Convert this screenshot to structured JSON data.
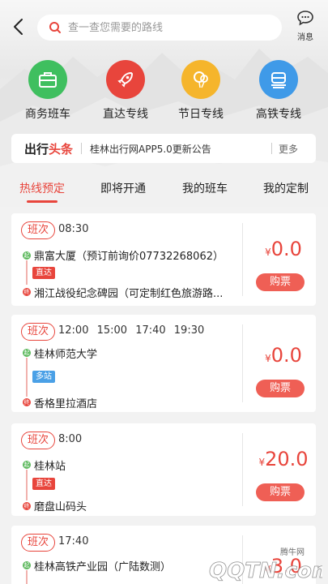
{
  "search": {
    "placeholder": "查一查您需要的路线"
  },
  "message": {
    "label": "消息"
  },
  "categories": [
    {
      "label": "商务班车",
      "icon": "briefcase-icon",
      "color": "#3fbf5f"
    },
    {
      "label": "直达专线",
      "icon": "rocket-icon",
      "color": "#e8453c"
    },
    {
      "label": "节日专线",
      "icon": "balloon-icon",
      "color": "#f5b52c"
    },
    {
      "label": "高铁专线",
      "icon": "train-icon",
      "color": "#3f9ae8"
    }
  ],
  "news": {
    "brand_left": "出行",
    "brand_right": "头条",
    "headline": "桂林出行网APP5.0更新公告",
    "more": "更多"
  },
  "tabs": [
    {
      "label": "热线预定",
      "active": true
    },
    {
      "label": "即将开通",
      "active": false
    },
    {
      "label": "我的班车",
      "active": false
    },
    {
      "label": "我的定制",
      "active": false
    }
  ],
  "trip_badge": "班次",
  "currency": "¥",
  "buy_label": "购票",
  "start_dot": "起",
  "end_dot": "终",
  "cards": [
    {
      "times": "08:30",
      "from": "鼎富大厦（预订前询价07732268062）",
      "tag": "直达",
      "to": "湘江战役纪念碑园（可定制红色旅游路...",
      "price": "0.0"
    },
    {
      "times": "12:00 15:00 17:40 19:30",
      "from": "桂林师范大学",
      "tag": "多站",
      "to": "香格里拉酒店",
      "price": "0.0"
    },
    {
      "times": "8:00",
      "from": "桂林站",
      "tag": "直达",
      "to": "磨盘山码头",
      "price": "20.0"
    },
    {
      "times": "17:40",
      "from": "桂林高铁产业园（广陆数测）",
      "tag": "",
      "to": "",
      "price": "3.0"
    }
  ],
  "watermark": {
    "top": "腾牛网",
    "main": "QQTN.com"
  }
}
